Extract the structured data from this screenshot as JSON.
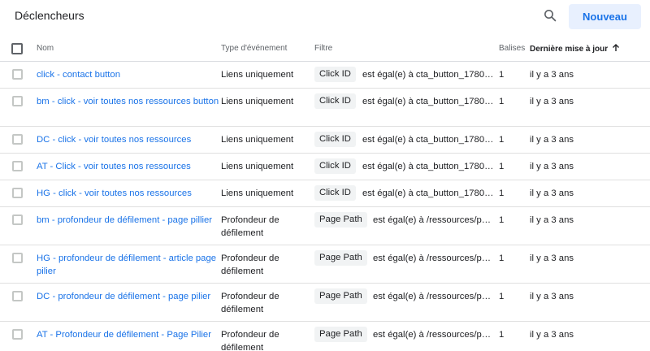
{
  "header": {
    "title": "Déclencheurs",
    "search_icon": "search-icon",
    "new_button": "Nouveau"
  },
  "columns": {
    "name": "Nom",
    "event_type": "Type d'événement",
    "filter": "Filtre",
    "tags": "Balises",
    "last_updated": "Dernière mise à jour",
    "sort_icon": "arrow-up-icon"
  },
  "rows": [
    {
      "name": "click - contact button",
      "event_type": "Liens uniquement",
      "filter_var": "Click ID",
      "filter_cond": "est égal(e) à cta_button_1780…",
      "tags": "1",
      "updated": "il y a 3 ans"
    },
    {
      "name": "bm - click - voir toutes nos ressources button",
      "event_type": "Liens uniquement",
      "filter_var": "Click ID",
      "filter_cond": "est égal(e) à cta_button_1780…",
      "tags": "1",
      "updated": "il y a 3 ans"
    },
    {
      "name": "DC - click - voir toutes nos ressources",
      "event_type": "Liens uniquement",
      "filter_var": "Click ID",
      "filter_cond": "est égal(e) à cta_button_1780…",
      "tags": "1",
      "updated": "il y a 3 ans"
    },
    {
      "name": "AT - Click - voir toutes nos ressources",
      "event_type": "Liens uniquement",
      "filter_var": "Click ID",
      "filter_cond": "est égal(e) à cta_button_1780…",
      "tags": "1",
      "updated": "il y a 3 ans"
    },
    {
      "name": "HG - click - voir toutes nos ressources",
      "event_type": "Liens uniquement",
      "filter_var": "Click ID",
      "filter_cond": "est égal(e) à cta_button_1780…",
      "tags": "1",
      "updated": "il y a 3 ans"
    },
    {
      "name": "bm - profondeur de défilement - page pillier",
      "event_type": "Profondeur de défilement",
      "filter_var": "Page Path",
      "filter_cond": "est égal(e) à /ressources/p…",
      "tags": "1",
      "updated": "il y a 3 ans"
    },
    {
      "name": "HG - profondeur de défilement - article page pilier",
      "event_type": "Profondeur de défilement",
      "filter_var": "Page Path",
      "filter_cond": "est égal(e) à /ressources/p…",
      "tags": "1",
      "updated": "il y a 3 ans"
    },
    {
      "name": "DC - profondeur de défilement - page pilier",
      "event_type": "Profondeur de défilement",
      "filter_var": "Page Path",
      "filter_cond": "est égal(e) à /ressources/p…",
      "tags": "1",
      "updated": "il y a 3 ans"
    },
    {
      "name": "AT - Profondeur de défilement - Page Pilier",
      "event_type": "Profondeur de défilement",
      "filter_var": "Page Path",
      "filter_cond": "est égal(e) à /ressources/p…",
      "tags": "1",
      "updated": "il y a 3 ans"
    }
  ],
  "colors": {
    "accent": "#1a73e8",
    "button_bg": "#e8f0fe",
    "chip_bg": "#f1f3f4"
  }
}
